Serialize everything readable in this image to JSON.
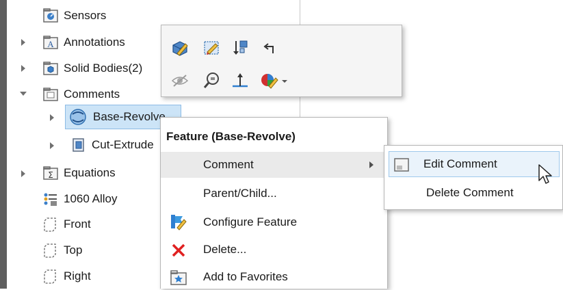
{
  "tree": {
    "items": [
      {
        "label": "Sensors",
        "icon": "sensors-icon"
      },
      {
        "label": "Annotations",
        "icon": "annotations-icon"
      },
      {
        "label": "Solid Bodies(2)",
        "icon": "solid-bodies-icon"
      },
      {
        "label": "Comments",
        "icon": "comments-folder-icon"
      },
      {
        "label": "Base-Revolve",
        "icon": "revolve-icon"
      },
      {
        "label": "Cut-Extrude",
        "icon": "cut-extrude-icon"
      },
      {
        "label": "Equations",
        "icon": "equations-icon"
      },
      {
        "label": "1060 Alloy",
        "icon": "material-icon"
      },
      {
        "label": "Front",
        "icon": "plane-icon"
      },
      {
        "label": "Top",
        "icon": "plane-icon"
      },
      {
        "label": "Right",
        "icon": "plane-icon"
      }
    ]
  },
  "context_menu": {
    "title": "Feature (Base-Revolve)",
    "items": [
      {
        "label": "Comment",
        "has_submenu": true
      },
      {
        "label": "Parent/Child...",
        "icon": ""
      },
      {
        "label": "Configure Feature",
        "icon": "configure-feature-icon"
      },
      {
        "label": "Delete...",
        "icon": "delete-x-icon"
      },
      {
        "label": "Add to Favorites",
        "icon": "favorites-icon"
      }
    ]
  },
  "submenu": {
    "items": [
      {
        "label": "Edit Comment",
        "icon": "edit-comment-icon"
      },
      {
        "label": "Delete Comment"
      }
    ]
  },
  "colors": {
    "selection_bg": "#cce4f7",
    "delete_red": "#e02020",
    "accent_blue": "#2f7fd0"
  }
}
